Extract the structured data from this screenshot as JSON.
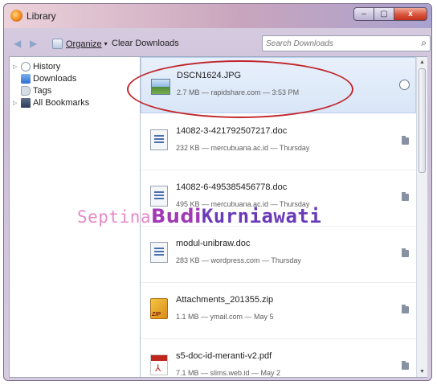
{
  "window": {
    "title": "Library",
    "buttons": [
      "–",
      "▢",
      "x"
    ]
  },
  "toolbar": {
    "back_icon": "arrow-left-icon",
    "forward_icon": "arrow-right-icon",
    "organize_label": "Organize",
    "organize_arrow": "▾",
    "clear_downloads_label": "Clear Downloads",
    "search_placeholder": "Search Downloads",
    "search_icon": "🔍"
  },
  "sidebar": {
    "items": [
      {
        "label": "History",
        "icon": "clock-icon",
        "expandable": true
      },
      {
        "label": "Downloads",
        "icon": "download-icon",
        "expandable": false
      },
      {
        "label": "Tags",
        "icon": "tag-icon",
        "expandable": false
      },
      {
        "label": "All Bookmarks",
        "icon": "bookmarks-icon",
        "expandable": true
      }
    ]
  },
  "downloads": [
    {
      "name": "DSCN1624.JPG",
      "meta": "2.7 MB — rapidshare.com — 3:53 PM",
      "icon": "image-file-icon",
      "action_icon": "retry-icon"
    },
    {
      "name": "14082-3-421792507217.doc",
      "meta": "232 KB — mercubuana.ac.id — Thursday",
      "icon": "doc-file-icon",
      "action_icon": "folder-icon"
    },
    {
      "name": "14082-6-495385456778.doc",
      "meta": "495 KB — mercubuana.ac.id — Thursday",
      "icon": "doc-file-icon",
      "action_icon": "folder-icon"
    },
    {
      "name": "modul-unibraw.doc",
      "meta": "283 KB — wordpress.com — Thursday",
      "icon": "doc-file-icon",
      "action_icon": "folder-icon"
    },
    {
      "name": "Attachments_201355.zip",
      "meta": "1.1 MB — ymail.com — May 5",
      "icon": "zip-file-icon",
      "action_icon": "folder-icon"
    },
    {
      "name": "s5-doc-id-meranti-v2.pdf",
      "meta": "7.1 MB — slims.web.id — May 2",
      "icon": "pdf-file-icon",
      "action_icon": "folder-icon"
    }
  ],
  "overlay": {
    "watermark": [
      "Septina",
      "Budi",
      "Kurniawati"
    ],
    "highlight_color": "#c0262c"
  },
  "colors": {
    "accent": "#2c6ed3",
    "selection": "#d9e6f7"
  }
}
